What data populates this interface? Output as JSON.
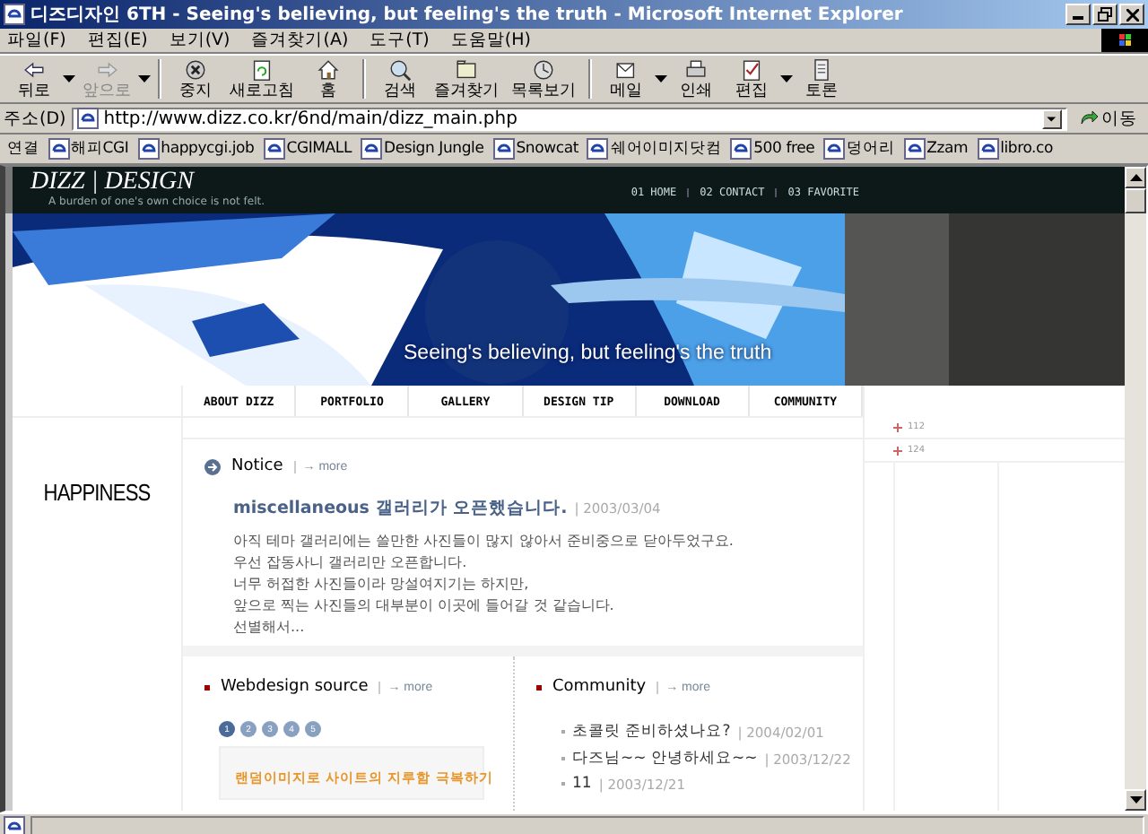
{
  "window": {
    "title": "디즈디자인 6TH - Seeing's believing, but feeling's the truth - Microsoft Internet Explorer"
  },
  "menu": [
    "파일(F)",
    "편집(E)",
    "보기(V)",
    "즐겨찾기(A)",
    "도구(T)",
    "도움말(H)"
  ],
  "toolbar": [
    {
      "kind": "back",
      "label": "뒤로",
      "disabled": false,
      "dropdown": true
    },
    {
      "kind": "forward",
      "label": "앞으로",
      "disabled": true,
      "dropdown": true
    },
    {
      "kind": "stop",
      "label": "중지",
      "disabled": false,
      "dropdown": false
    },
    {
      "kind": "refresh",
      "label": "새로고침",
      "disabled": false,
      "dropdown": false
    },
    {
      "kind": "home",
      "label": "홈",
      "disabled": false,
      "dropdown": false
    },
    {
      "kind": "search",
      "label": "검색",
      "disabled": false,
      "dropdown": false
    },
    {
      "kind": "favorites",
      "label": "즐겨찾기",
      "disabled": false,
      "dropdown": false
    },
    {
      "kind": "history",
      "label": "목록보기",
      "disabled": false,
      "dropdown": false
    },
    {
      "kind": "mail",
      "label": "메일",
      "disabled": false,
      "dropdown": true
    },
    {
      "kind": "print",
      "label": "인쇄",
      "disabled": false,
      "dropdown": false
    },
    {
      "kind": "edit",
      "label": "편집",
      "disabled": false,
      "dropdown": true
    },
    {
      "kind": "discuss",
      "label": "토론",
      "disabled": false,
      "dropdown": false
    }
  ],
  "address": {
    "label": "주소(D)",
    "url": "http://www.dizz.co.kr/6nd/main/dizz_main.php",
    "go": "이동"
  },
  "links": {
    "label": "연결",
    "items": [
      "해피CGI",
      "happycgi.job",
      "CGIMALL",
      "Design Jungle",
      "Snowcat",
      "쉐어이미지닷컴",
      "500 free",
      "덩어리",
      "Zzam",
      "libro.co"
    ]
  },
  "site": {
    "logo": "DIZZ | DESIGN",
    "tagline": "A burden of one's own choice is not felt.",
    "top_nav": [
      "01 HOME",
      "02 CONTACT",
      "03 FAVORITE"
    ],
    "banner_caption": "Seeing's believing, but feeling's the truth",
    "menu": [
      "ABOUT DIZZ",
      "PORTFOLIO",
      "GALLERY",
      "DESIGN TIP",
      "DOWNLOAD",
      "COMMUNITY"
    ],
    "side_marks": [
      "112",
      "124"
    ],
    "section_title": "HAPPINESS",
    "notice": {
      "title": "Notice",
      "more": "→ more",
      "headline": "miscellaneous 갤러리가 오픈했습니다.",
      "date": "| 2003/03/04",
      "lines": [
        "아직 테마 갤러리에는 쓸만한 사진들이 많지 않아서 준비중으로 닫아두었구요.",
        "우선 잡동사니 갤러리만 오픈합니다.",
        "너무 허접한 사진들이라 망설여지기는 하지만,",
        "앞으로 찍는 사진들의 대부분이 이곳에 들어갈 것 같습니다.",
        "선별해서..."
      ]
    },
    "webdesign": {
      "title": "Webdesign source",
      "more": "→ more",
      "pages": [
        {
          "label": "1",
          "selected": true
        },
        {
          "label": "2",
          "selected": false
        },
        {
          "label": "3",
          "selected": false
        },
        {
          "label": "4",
          "selected": false
        },
        {
          "label": "5",
          "selected": false
        }
      ],
      "article": "랜덤이미지로 사이트의 지루함 극복하기"
    },
    "community": {
      "title": "Community",
      "more": "→ more",
      "posts": [
        {
          "title": "초콜릿 준비하셨나요?",
          "date": "| 2004/02/01"
        },
        {
          "title": "다즈님~~ 안녕하세요~~",
          "date": "| 2003/12/22"
        },
        {
          "title": "11",
          "date": "| 2003/12/21"
        }
      ]
    }
  }
}
